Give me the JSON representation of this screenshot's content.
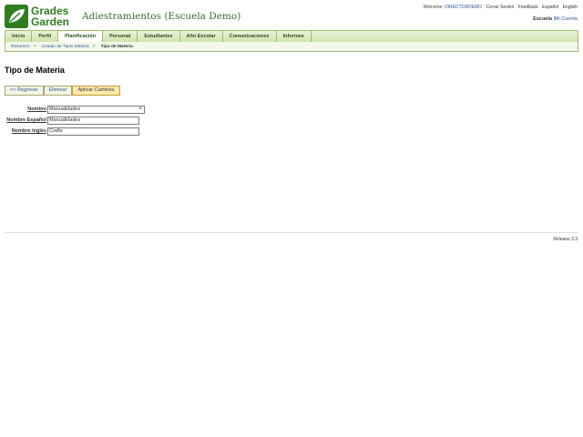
{
  "header": {
    "logo": {
      "line1": "Grades",
      "line2": "Garden"
    },
    "school_title": "Adiestramientos (Escuela Demo)",
    "welcome_label": "Welcome:",
    "user": "DIRECTORDEMO",
    "links": [
      "Cerrar Sesión",
      "Feedback",
      "Español",
      "English"
    ],
    "scope_label": "Escuela",
    "scope_sep": "|",
    "account_link": "Mi Cuenta"
  },
  "nav": {
    "tabs": [
      "Inicio",
      "Perfil",
      "Planificación",
      "Personal",
      "Estudiantes",
      "Año Escolar",
      "Comunicaciones",
      "Informes"
    ],
    "active": "Planificación"
  },
  "breadcrumb": {
    "items": [
      "Resumen",
      "Listado de Tipos Materia",
      "Tipo de Materia"
    ],
    "separator": ">"
  },
  "page": {
    "title": "Tipo de Materia",
    "buttons": {
      "back": "<< Regresar",
      "delete": "Eliminar",
      "apply": "Aplicar Cambios"
    }
  },
  "form": {
    "fields": [
      {
        "label": "Nombre",
        "value": "Manualidades"
      },
      {
        "label": "Nombre Español",
        "value": "Manualidades"
      },
      {
        "label": "Nombre Inglés",
        "value": "Crafts"
      }
    ]
  },
  "footer": {
    "release": "Release 3.3"
  },
  "colors": {
    "brand": "#2f7d1f",
    "nav_bg": "#cfe3ad",
    "link": "#2d5a9a",
    "apply_bg": "#ffe9b0"
  },
  "icons": {
    "clear": "close-icon",
    "logo": "leaf-icon"
  }
}
